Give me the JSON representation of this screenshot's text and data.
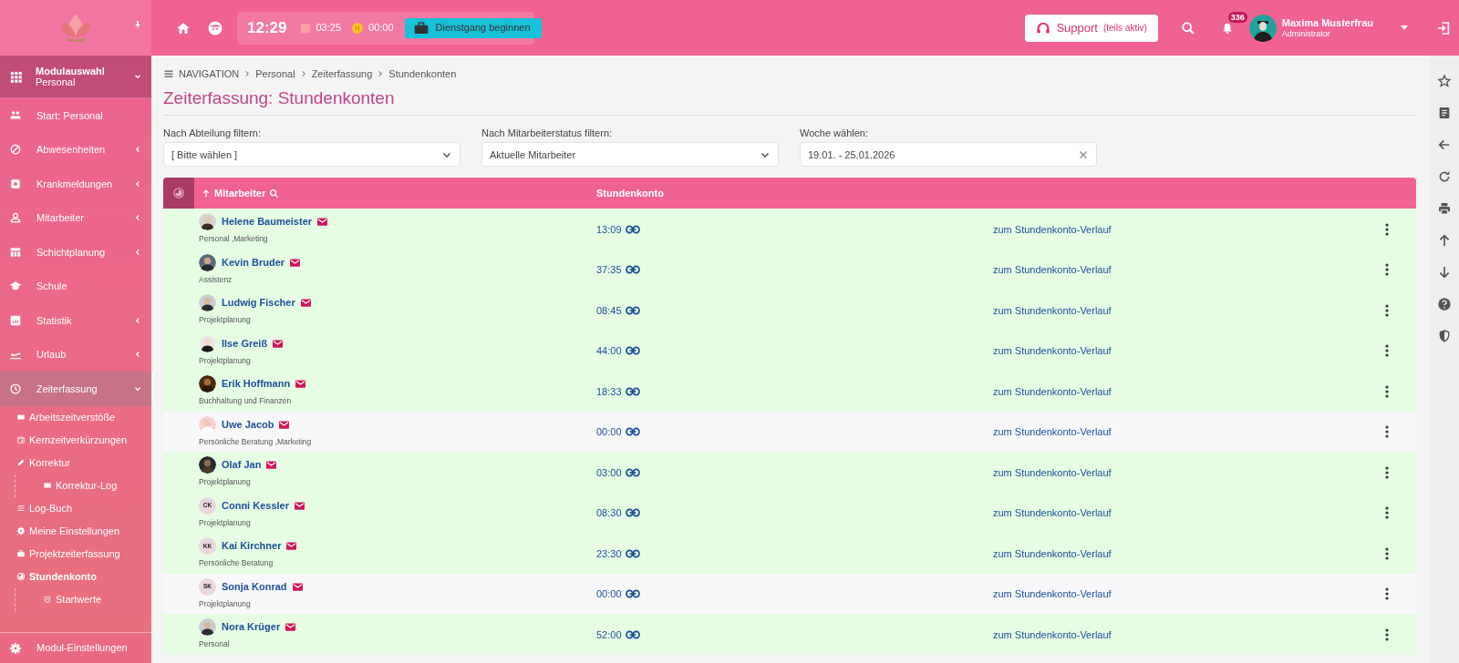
{
  "topbar": {
    "clock": "12:29",
    "work_timer": "03:25",
    "pause_timer": "00:00",
    "duty_button": "Dienstgang beginnen",
    "support": {
      "label": "Support",
      "note": "(teils aktiv)"
    },
    "notifications": "336",
    "user": {
      "name": "Maxima Musterfrau",
      "role": "Administrator"
    }
  },
  "sidebar": {
    "module": {
      "title": "Modulauswahl",
      "subtitle": "Personal",
      "expanded": true
    },
    "items": [
      {
        "kind": "link",
        "label": "Start: Personal",
        "selected": false
      },
      {
        "kind": "group",
        "label": "Abwesenheiten",
        "expanded": false,
        "selected": false
      },
      {
        "kind": "group",
        "label": "Krankmeldungen",
        "expanded": false,
        "selected": false
      },
      {
        "kind": "group",
        "label": "Mitarbeiter",
        "expanded": false,
        "selected": false
      },
      {
        "kind": "group",
        "label": "Schichtplanung",
        "expanded": false,
        "selected": false
      },
      {
        "kind": "link",
        "label": "Schule",
        "selected": false
      },
      {
        "kind": "group",
        "label": "Statistik",
        "expanded": false,
        "selected": false
      },
      {
        "kind": "group",
        "label": "Urlaub",
        "expanded": false,
        "selected": false
      },
      {
        "kind": "group",
        "label": "Zeiterfassung",
        "expanded": true,
        "selected": true,
        "children": [
          {
            "label": "Arbeitszeitverstöße",
            "selected": false
          },
          {
            "label": "Kernzeitverkürzungen",
            "selected": false
          },
          {
            "label": "Korrektur",
            "selected": false,
            "children": [
              {
                "label": "Korrektur-Log",
                "selected": false
              }
            ]
          },
          {
            "label": "Log-Buch",
            "selected": false
          },
          {
            "label": "Meine Einstellungen",
            "selected": false
          },
          {
            "label": "Projektzeiterfassung",
            "selected": false
          },
          {
            "label": "Stundenkonto",
            "selected": true,
            "children": [
              {
                "label": "Startwerte",
                "selected": false
              }
            ]
          }
        ]
      }
    ],
    "footer": "Modul-Einstellungen"
  },
  "breadcrumb": [
    "NAVIGATION",
    "Personal",
    "Zeiterfassung",
    "Stundenkonten"
  ],
  "title": "Zeiterfassung: Stundenkonten",
  "filters": [
    {
      "kind": "select",
      "label": "Nach Abteilung filtern:",
      "value": "[ Bitte wählen ]"
    },
    {
      "kind": "select",
      "label": "Nach Mitarbeiterstatus filtern:",
      "value": "Aktuelle Mitarbeiter"
    },
    {
      "kind": "date",
      "label": "Woche wählen:",
      "value": "19.01. - 25.01.2026"
    }
  ],
  "table": {
    "columns": [
      {
        "label": "Mitarbeiter",
        "sorted": true
      },
      {
        "label": "Stundenkonto",
        "sorted": false
      }
    ],
    "rows": [
      {
        "name": "Helene Baumeister",
        "departments": "Personal ,Marketing",
        "balance": "13:09",
        "link": "zum Stundenkonto-Verlauf",
        "highlighted": true
      },
      {
        "name": "Kevin Bruder",
        "departments": "Assistenz",
        "balance": "37:35",
        "link": "zum Stundenkonto-Verlauf",
        "highlighted": true
      },
      {
        "name": "Ludwig Fischer",
        "departments": "Projektplanung",
        "balance": "08:45",
        "link": "zum Stundenkonto-Verlauf",
        "highlighted": true
      },
      {
        "name": "Ilse Greiß",
        "departments": "Projektplanung",
        "balance": "44:00",
        "link": "zum Stundenkonto-Verlauf",
        "highlighted": true
      },
      {
        "name": "Erik Hoffmann",
        "departments": "Buchhaltung und Finanzen",
        "balance": "18:33",
        "link": "zum Stundenkonto-Verlauf",
        "highlighted": true
      },
      {
        "name": "Uwe Jacob",
        "departments": "Persönliche Beratung ,Marketing",
        "balance": "00:00",
        "link": "zum Stundenkonto-Verlauf",
        "highlighted": false
      },
      {
        "name": "Olaf Jan",
        "departments": "Projektplanung",
        "balance": "03:00",
        "link": "zum Stundenkonto-Verlauf",
        "highlighted": true
      },
      {
        "name": "Conni Kessler",
        "departments": "Projektplanung",
        "avatar": {
          "kind": "initials",
          "text": "CK"
        },
        "balance": "08:30",
        "link": "zum Stundenkonto-Verlauf",
        "highlighted": true
      },
      {
        "name": "Kai Kirchner",
        "departments": "Persönliche Beratung",
        "avatar": {
          "kind": "initials",
          "text": "KK"
        },
        "balance": "23:30",
        "link": "zum Stundenkonto-Verlauf",
        "highlighted": true
      },
      {
        "name": "Sonja Konrad",
        "departments": "Projektplanung",
        "avatar": {
          "kind": "initials",
          "text": "SK"
        },
        "balance": "00:00",
        "link": "zum Stundenkonto-Verlauf",
        "highlighted": false
      },
      {
        "name": "Nora Krüger",
        "departments": "Personal",
        "balance": "52:00",
        "link": "zum Stundenkonto-Verlauf",
        "highlighted": true
      }
    ]
  }
}
